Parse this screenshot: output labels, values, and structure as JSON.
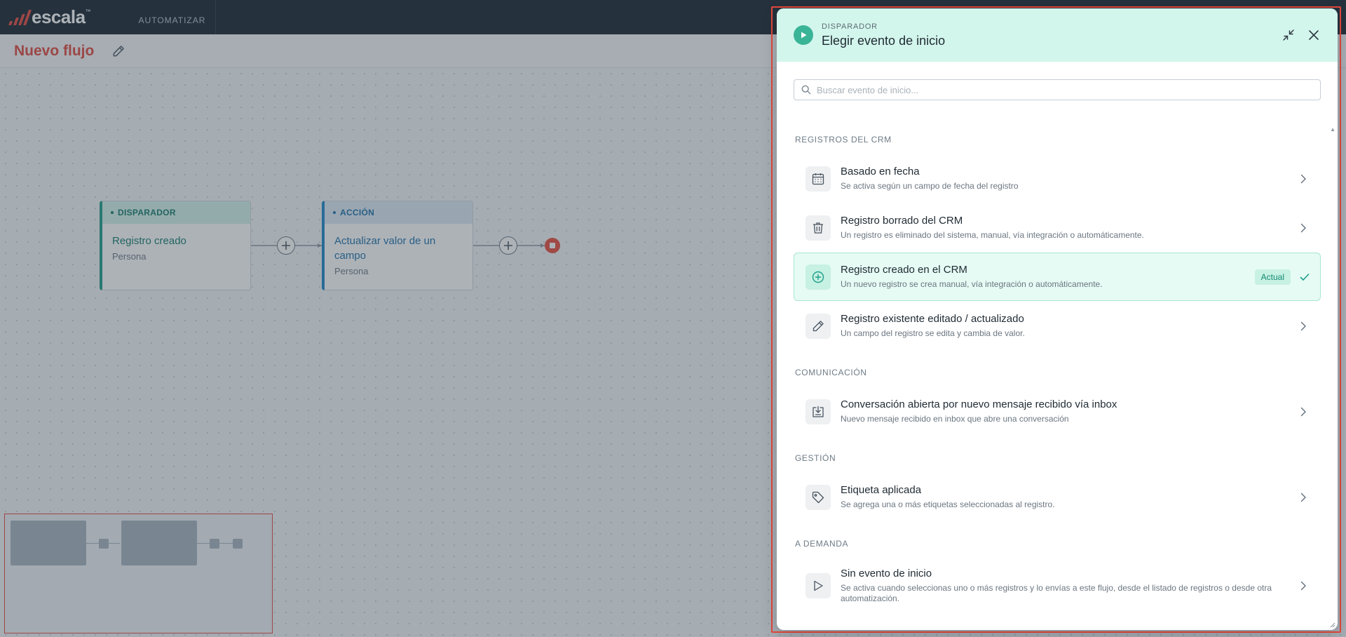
{
  "app": {
    "logo_text": "escala",
    "logo_tm": "™",
    "nav": [
      "AUTOMATIZAR"
    ]
  },
  "flow": {
    "title": "Nuevo flujo",
    "nodes": [
      {
        "type_label": "DISPARADOR",
        "title": "Registro creado",
        "subtitle": "Persona"
      },
      {
        "type_label": "ACCIÓN",
        "title": "Actualizar valor de un campo",
        "subtitle": "Persona"
      }
    ]
  },
  "panel": {
    "eyebrow": "DISPARADOR",
    "title": "Elegir evento de inicio",
    "search_placeholder": "Buscar evento de inicio...",
    "current_badge": "Actual",
    "sections": [
      {
        "title": "REGISTROS DEL CRM",
        "items": [
          {
            "icon": "calendar-icon",
            "title": "Basado en fecha",
            "desc": "Se activa según un campo de fecha del registro"
          },
          {
            "icon": "trash-icon",
            "title": "Registro borrado del CRM",
            "desc": "Un registro es eliminado del sistema, manual, vía integración o automáticamente."
          },
          {
            "icon": "plus-circle-icon",
            "title": "Registro creado en el CRM",
            "desc": "Un nuevo registro se crea manual, vía integración o automáticamente.",
            "current": true
          },
          {
            "icon": "pencil-icon",
            "title": "Registro existente editado / actualizado",
            "desc": "Un campo del registro se edita y cambia de valor."
          }
        ]
      },
      {
        "title": "COMUNICACIÓN",
        "items": [
          {
            "icon": "inbox-download-icon",
            "title": "Conversación abierta por nuevo mensaje recibido vía inbox",
            "desc": "Nuevo mensaje recibido en inbox que abre una conversación"
          }
        ]
      },
      {
        "title": "GESTIÓN",
        "items": [
          {
            "icon": "tag-icon",
            "title": "Etiqueta aplicada",
            "desc": "Se agrega una o más etiquetas seleccionadas al registro."
          }
        ]
      },
      {
        "title": "A DEMANDA",
        "items": [
          {
            "icon": "play-icon",
            "title": "Sin evento de inicio",
            "desc": "Se activa cuando seleccionas uno o más registros y lo envías a este flujo, desde el listado de registros o desde otra automatización."
          }
        ]
      }
    ]
  },
  "colors": {
    "brand_red": "#e5483d",
    "trigger_green": "#1d9e8a",
    "action_blue": "#1a85c8",
    "panel_header_bg": "#d3f6ec",
    "topbar_bg": "#15232e"
  }
}
